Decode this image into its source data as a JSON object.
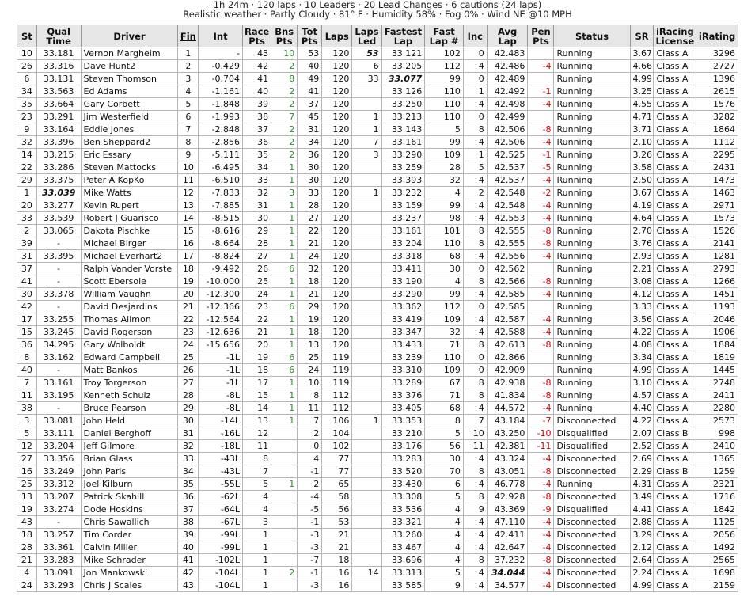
{
  "summary": {
    "line1": "1h 24m · 120 laps · 10 Leaders · 20 Lead Changes · 6 cautions (24 laps)",
    "line2": "Realistic weather · Partly Cloudy · 81° F · Humidity 58% · Fog 0% · Wind NE @10 MPH"
  },
  "columns": [
    "St",
    "Qual Time",
    "Driver",
    "Fin",
    "Int",
    "Race Pts",
    "Bns Pts",
    "Tot Pts",
    "Laps",
    "Laps Led",
    "Fastest Lap",
    "Fast Lap #",
    "Inc",
    "Avg Lap",
    "Pen Pts",
    "Status",
    "SR",
    "iRacing License",
    "iRating"
  ],
  "rows": [
    [
      "10",
      "33.181",
      "Vernon Margheim",
      "1",
      "-",
      "43",
      "10",
      "53",
      "120",
      "53",
      "33.121",
      "102",
      "0",
      "42.483",
      "",
      "Running",
      "3.67",
      "Class A",
      "3296"
    ],
    [
      "26",
      "33.316",
      "Dave Hunt2",
      "2",
      "-0.429",
      "42",
      "2",
      "40",
      "120",
      "6",
      "33.205",
      "112",
      "4",
      "42.486",
      "-4",
      "Running",
      "4.66",
      "Class A",
      "2727"
    ],
    [
      "6",
      "33.131",
      "Steven Thomson",
      "3",
      "-0.704",
      "41",
      "8",
      "49",
      "120",
      "33",
      "33.077",
      "99",
      "0",
      "42.489",
      "",
      "Running",
      "4.99",
      "Class A",
      "1396"
    ],
    [
      "34",
      "33.563",
      "Ed Adams",
      "4",
      "-1.161",
      "40",
      "2",
      "41",
      "120",
      "",
      "33.126",
      "110",
      "1",
      "42.492",
      "-1",
      "Running",
      "3.25",
      "Class A",
      "2615"
    ],
    [
      "35",
      "33.664",
      "Gary Corbett",
      "5",
      "-1.848",
      "39",
      "2",
      "37",
      "120",
      "",
      "33.250",
      "110",
      "4",
      "42.498",
      "-4",
      "Running",
      "4.55",
      "Class A",
      "1576"
    ],
    [
      "23",
      "33.291",
      "Jim Westerfield",
      "6",
      "-1.993",
      "38",
      "7",
      "45",
      "120",
      "1",
      "33.213",
      "110",
      "0",
      "42.499",
      "",
      "Running",
      "4.71",
      "Class A",
      "3282"
    ],
    [
      "9",
      "33.164",
      "Eddie Jones",
      "7",
      "-2.848",
      "37",
      "2",
      "31",
      "120",
      "1",
      "33.143",
      "5",
      "8",
      "42.506",
      "-8",
      "Running",
      "3.71",
      "Class A",
      "1864"
    ],
    [
      "32",
      "33.396",
      "Ben Sheppard2",
      "8",
      "-2.856",
      "36",
      "2",
      "34",
      "120",
      "7",
      "33.161",
      "99",
      "4",
      "42.506",
      "-4",
      "Running",
      "2.10",
      "Class A",
      "1112"
    ],
    [
      "14",
      "33.215",
      "Eric Essary",
      "9",
      "-5.111",
      "35",
      "2",
      "36",
      "120",
      "3",
      "33.290",
      "109",
      "1",
      "42.525",
      "-1",
      "Running",
      "3.26",
      "Class A",
      "2295"
    ],
    [
      "22",
      "33.286",
      "Steven Mattocks",
      "10",
      "-6.495",
      "34",
      "1",
      "30",
      "120",
      "",
      "33.259",
      "28",
      "5",
      "42.537",
      "-5",
      "Running",
      "3.58",
      "Class A",
      "2431"
    ],
    [
      "29",
      "33.375",
      "Peter A KopKo",
      "11",
      "-6.510",
      "33",
      "1",
      "30",
      "120",
      "",
      "33.393",
      "32",
      "4",
      "42.537",
      "-4",
      "Running",
      "2.50",
      "Class A",
      "1473"
    ],
    [
      "1",
      "33.039",
      "Mike Watts",
      "12",
      "-7.833",
      "32",
      "3",
      "33",
      "120",
      "1",
      "33.232",
      "4",
      "2",
      "42.548",
      "-2",
      "Running",
      "3.67",
      "Class A",
      "1463"
    ],
    [
      "20",
      "33.277",
      "Kevin Rupert",
      "13",
      "-7.885",
      "31",
      "1",
      "28",
      "120",
      "",
      "33.159",
      "99",
      "4",
      "42.548",
      "-4",
      "Running",
      "4.19",
      "Class A",
      "2971"
    ],
    [
      "33",
      "33.539",
      "Robert J Guarisco",
      "14",
      "-8.515",
      "30",
      "1",
      "27",
      "120",
      "",
      "33.237",
      "98",
      "4",
      "42.553",
      "-4",
      "Running",
      "4.64",
      "Class A",
      "1573"
    ],
    [
      "2",
      "33.065",
      "Dakota Pischke",
      "15",
      "-8.616",
      "29",
      "1",
      "22",
      "120",
      "",
      "33.161",
      "101",
      "8",
      "42.555",
      "-8",
      "Running",
      "2.70",
      "Class A",
      "1526"
    ],
    [
      "39",
      "-",
      "Michael Birger",
      "16",
      "-8.664",
      "28",
      "1",
      "21",
      "120",
      "",
      "33.204",
      "110",
      "8",
      "42.555",
      "-8",
      "Running",
      "3.76",
      "Class A",
      "2141"
    ],
    [
      "31",
      "33.395",
      "Michael Everhart2",
      "17",
      "-8.824",
      "27",
      "1",
      "24",
      "120",
      "",
      "33.318",
      "68",
      "4",
      "42.556",
      "-4",
      "Running",
      "2.93",
      "Class A",
      "1281"
    ],
    [
      "37",
      "-",
      "Ralph Vander Vorste",
      "18",
      "-9.492",
      "26",
      "6",
      "32",
      "120",
      "",
      "33.411",
      "30",
      "0",
      "42.562",
      "",
      "Running",
      "2.21",
      "Class A",
      "2793"
    ],
    [
      "41",
      "-",
      "Scott Ebersole",
      "19",
      "-10.000",
      "25",
      "1",
      "18",
      "120",
      "",
      "33.190",
      "4",
      "8",
      "42.566",
      "-8",
      "Running",
      "3.08",
      "Class A",
      "1266"
    ],
    [
      "30",
      "33.378",
      "William Vaughn",
      "20",
      "-12.300",
      "24",
      "1",
      "21",
      "120",
      "",
      "33.290",
      "99",
      "4",
      "42.585",
      "-4",
      "Running",
      "4.12",
      "Class A",
      "1451"
    ],
    [
      "42",
      "-",
      "David Desjardins",
      "21",
      "-12.366",
      "23",
      "6",
      "29",
      "120",
      "",
      "33.362",
      "112",
      "0",
      "42.585",
      "",
      "Running",
      "3.33",
      "Class A",
      "1193"
    ],
    [
      "17",
      "33.255",
      "Thomas Allmon",
      "22",
      "-12.564",
      "22",
      "1",
      "19",
      "120",
      "",
      "33.419",
      "109",
      "4",
      "42.587",
      "-4",
      "Running",
      "3.56",
      "Class A",
      "2046"
    ],
    [
      "15",
      "33.245",
      "David Rogerson",
      "23",
      "-12.636",
      "21",
      "1",
      "18",
      "120",
      "",
      "33.347",
      "32",
      "4",
      "42.588",
      "-4",
      "Running",
      "4.22",
      "Class A",
      "1906"
    ],
    [
      "36",
      "34.295",
      "Gary Wolboldt",
      "24",
      "-15.656",
      "20",
      "1",
      "13",
      "120",
      "",
      "33.433",
      "71",
      "8",
      "42.613",
      "-8",
      "Running",
      "4.08",
      "Class A",
      "1884"
    ],
    [
      "8",
      "33.162",
      "Edward Campbell",
      "25",
      "-1L",
      "19",
      "6",
      "25",
      "119",
      "",
      "33.239",
      "110",
      "0",
      "42.866",
      "",
      "Running",
      "3.34",
      "Class A",
      "1819"
    ],
    [
      "40",
      "-",
      "Matt Bankos",
      "26",
      "-1L",
      "18",
      "6",
      "24",
      "119",
      "",
      "33.310",
      "109",
      "0",
      "42.909",
      "",
      "Running",
      "4.99",
      "Class A",
      "1445"
    ],
    [
      "7",
      "33.161",
      "Troy Torgerson",
      "27",
      "-1L",
      "17",
      "1",
      "10",
      "119",
      "",
      "33.289",
      "67",
      "8",
      "42.938",
      "-8",
      "Running",
      "3.10",
      "Class A",
      "2748"
    ],
    [
      "11",
      "33.195",
      "Kenneth Schulz",
      "28",
      "-8L",
      "15",
      "1",
      "8",
      "112",
      "",
      "33.376",
      "71",
      "8",
      "41.834",
      "-8",
      "Running",
      "4.57",
      "Class A",
      "2411"
    ],
    [
      "38",
      "-",
      "Bruce Pearson",
      "29",
      "-8L",
      "14",
      "1",
      "11",
      "112",
      "",
      "33.405",
      "68",
      "4",
      "44.572",
      "-4",
      "Running",
      "4.40",
      "Class A",
      "2280"
    ],
    [
      "3",
      "33.081",
      "John Held",
      "30",
      "-14L",
      "13",
      "1",
      "7",
      "106",
      "1",
      "33.353",
      "8",
      "7",
      "43.184",
      "-7",
      "Disconnected",
      "4.22",
      "Class A",
      "2573"
    ],
    [
      "5",
      "33.111",
      "Daniel Berghoff",
      "31",
      "-16L",
      "12",
      "",
      "2",
      "104",
      "",
      "33.210",
      "5",
      "10",
      "43.250",
      "-10",
      "Disqualified",
      "2.07",
      "Class B",
      "998"
    ],
    [
      "12",
      "33.204",
      "Jeff Gilmore",
      "32",
      "-18L",
      "11",
      "",
      "0",
      "102",
      "",
      "33.176",
      "56",
      "11",
      "42.381",
      "-11",
      "Disqualified",
      "2.52",
      "Class A",
      "2410"
    ],
    [
      "27",
      "33.356",
      "Brian Glass",
      "33",
      "-43L",
      "8",
      "",
      "4",
      "77",
      "",
      "33.283",
      "30",
      "4",
      "43.324",
      "-4",
      "Disconnected",
      "2.69",
      "Class A",
      "1365"
    ],
    [
      "16",
      "33.249",
      "John Paris",
      "34",
      "-43L",
      "7",
      "",
      "-1",
      "77",
      "",
      "33.520",
      "70",
      "8",
      "43.051",
      "-8",
      "Disconnected",
      "2.29",
      "Class B",
      "1259"
    ],
    [
      "25",
      "33.312",
      "Joel Kilburn",
      "35",
      "-55L",
      "5",
      "1",
      "2",
      "65",
      "",
      "33.430",
      "6",
      "4",
      "46.778",
      "-4",
      "Running",
      "4.31",
      "Class A",
      "2321"
    ],
    [
      "13",
      "33.207",
      "Patrick Skahill",
      "36",
      "-62L",
      "4",
      "",
      "-4",
      "58",
      "",
      "33.308",
      "5",
      "8",
      "42.928",
      "-8",
      "Disconnected",
      "3.49",
      "Class A",
      "1716"
    ],
    [
      "19",
      "33.274",
      "Dode Hoskins",
      "37",
      "-64L",
      "4",
      "",
      "-5",
      "56",
      "",
      "33.536",
      "4",
      "9",
      "43.369",
      "-9",
      "Disqualified",
      "4.41",
      "Class A",
      "1842"
    ],
    [
      "43",
      "-",
      "Chris Sawallich",
      "38",
      "-67L",
      "3",
      "",
      "-1",
      "53",
      "",
      "33.321",
      "4",
      "4",
      "47.110",
      "-4",
      "Disconnected",
      "2.88",
      "Class A",
      "1125"
    ],
    [
      "18",
      "33.257",
      "Tim Corder",
      "39",
      "-99L",
      "1",
      "",
      "-3",
      "21",
      "",
      "33.260",
      "4",
      "4",
      "42.411",
      "-4",
      "Disconnected",
      "3.29",
      "Class A",
      "2056"
    ],
    [
      "28",
      "33.361",
      "Calvin Miller",
      "40",
      "-99L",
      "1",
      "",
      "-3",
      "21",
      "",
      "33.467",
      "4",
      "4",
      "42.647",
      "-4",
      "Disconnected",
      "2.12",
      "Class A",
      "1492"
    ],
    [
      "21",
      "33.283",
      "Mike Schrader",
      "41",
      "-102L",
      "1",
      "",
      "-7",
      "18",
      "",
      "33.696",
      "4",
      "8",
      "37.232",
      "-8",
      "Disconnected",
      "2.64",
      "Class A",
      "2565"
    ],
    [
      "4",
      "33.091",
      "Jon Mankowski",
      "42",
      "-104L",
      "1",
      "2",
      "-1",
      "16",
      "14",
      "33.313",
      "5",
      "4",
      "34.044",
      "-4",
      "Disconnected",
      "2.24",
      "Class A",
      "1698"
    ],
    [
      "24",
      "33.293",
      "Chris J Scales",
      "43",
      "-104L",
      "1",
      "",
      "-3",
      "16",
      "",
      "33.585",
      "9",
      "4",
      "34.577",
      "-4",
      "Disconnected",
      "4.99",
      "Class A",
      "2159"
    ]
  ],
  "highlights": {
    "qual_best_row": 11,
    "laps_led_best_row": 0,
    "fastest_lap_best_row": 2,
    "avg_lap_best_row": 41
  },
  "colors": {
    "header_bg": "#e6e6e6",
    "bonus_green": "#2e8b2e",
    "penalty_red": "#cc0000"
  }
}
